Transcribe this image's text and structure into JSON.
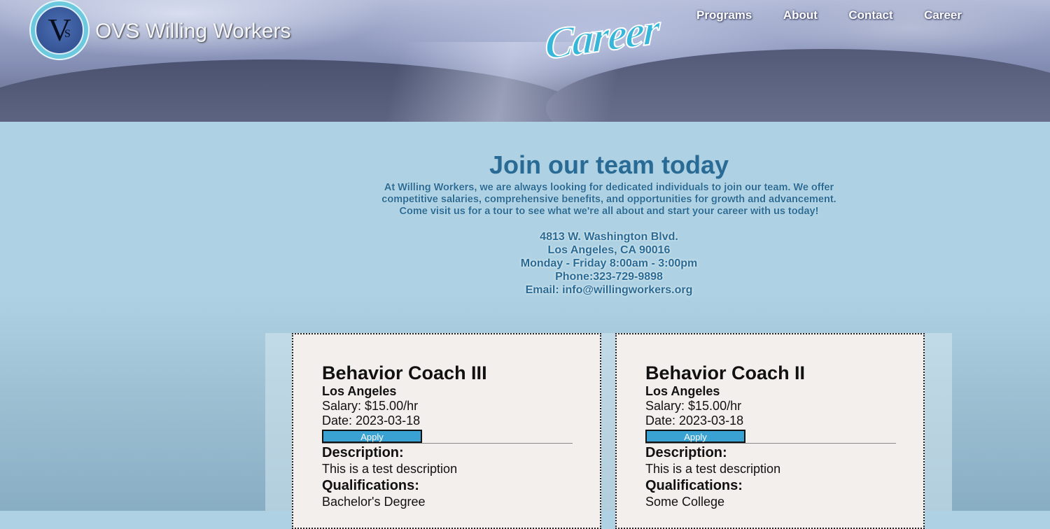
{
  "site": {
    "title": "OVS Willing Workers",
    "logo_letter": "V",
    "logo_sub": "S",
    "header_script": "Career"
  },
  "nav": [
    {
      "label": "Programs"
    },
    {
      "label": "About"
    },
    {
      "label": "Contact"
    },
    {
      "label": "Career"
    }
  ],
  "intro": {
    "heading": "Join our team today",
    "paragraph_lines": [
      "At Willing Workers, we are always looking for dedicated individuals to join our team. We offer",
      "competitive salaries, comprehensive benefits, and opportunities for growth and advancement.",
      "Come visit us for a tour to see what we're all about and start your career with us today!"
    ],
    "address_lines": [
      "4813 W. Washington Blvd.",
      "Los Angeles, CA 90016",
      "Monday - Friday 8:00am - 3:00pm",
      "Phone:323-729-9898",
      "Email: info@willingworkers.org"
    ]
  },
  "jobs": [
    {
      "title": "Behavior Coach III",
      "location": "Los Angeles",
      "salary": "Salary: $15.00/hr",
      "date": "Date: 2023-03-18",
      "apply_label": "Apply",
      "description_heading": "Description:",
      "description": "This is a test description",
      "qualifications_heading": "Qualifications:",
      "qualifications": "Bachelor's Degree"
    },
    {
      "title": "Behavior Coach II",
      "location": "Los Angeles",
      "salary": "Salary: $15.00/hr",
      "date": "Date: 2023-03-18",
      "apply_label": "Apply",
      "description_heading": "Description:",
      "description": "This is a test description",
      "qualifications_heading": "Qualifications:",
      "qualifications": "Some College"
    }
  ],
  "colors": {
    "page_background": "#aed2e3",
    "heading_text": "#2a6b95",
    "apply_button": "#3aa2d2",
    "card_background": "#f3efed",
    "script_title": "#36b6d8"
  }
}
